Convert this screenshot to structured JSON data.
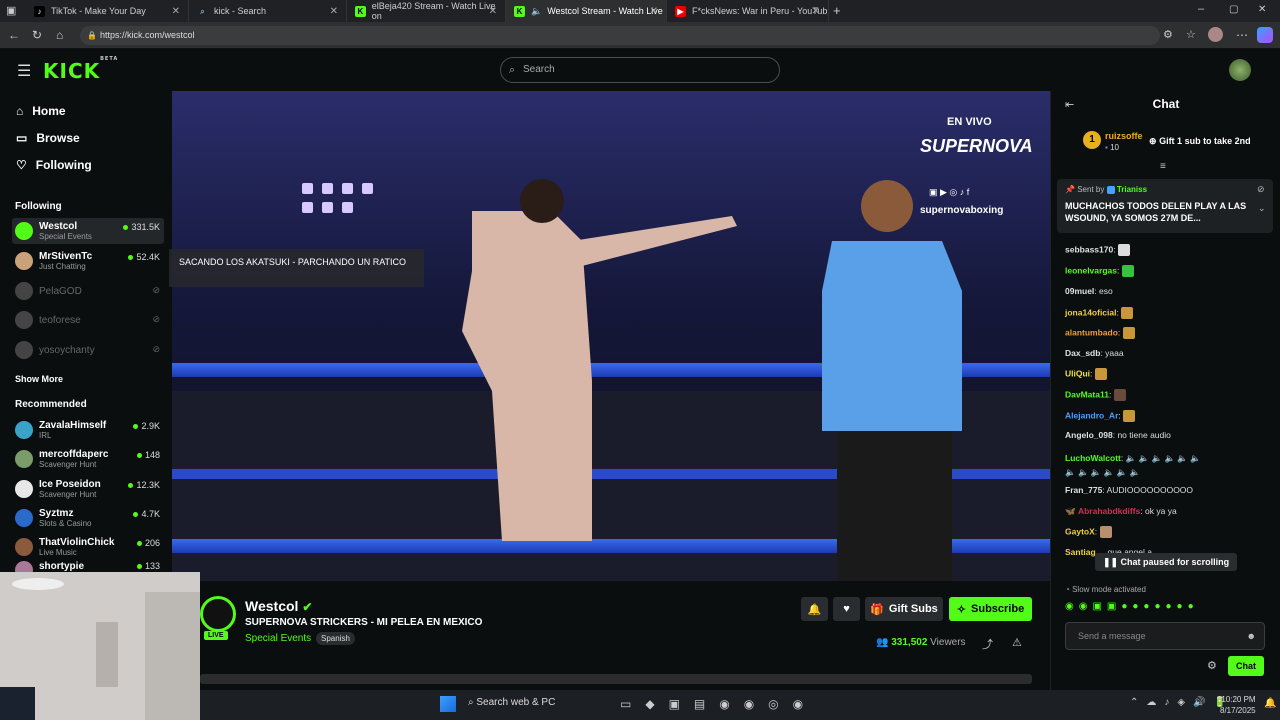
{
  "browser": {
    "tabs": [
      {
        "label": "TikTok - Make Your Day",
        "icon": "tiktok-icon"
      },
      {
        "label": "kick - Search",
        "icon": "search-icon"
      },
      {
        "label": "elBeja420 Stream - Watch Live on",
        "icon": "kick-icon"
      },
      {
        "label": "Westcol Stream - Watch Live",
        "icon": "kick-icon"
      },
      {
        "label": "F*cksNews: War in Peru - YouTub",
        "icon": "youtube-icon"
      }
    ],
    "url": "https://kick.com/westcol"
  },
  "header": {
    "logo": "KICK",
    "logo_badge": "BETA",
    "search_placeholder": "Search"
  },
  "sidebar": {
    "nav": [
      {
        "label": "Home"
      },
      {
        "label": "Browse"
      },
      {
        "label": "Following"
      }
    ],
    "following_title": "Following",
    "following": [
      {
        "name": "Westcol",
        "category": "Special Events",
        "viewers": "331.5K",
        "live": true,
        "color": "#53fc18"
      },
      {
        "name": "MrStivenTc",
        "category": "Just Chatting",
        "viewers": "52.4K",
        "live": true,
        "color": "#c9a27a"
      },
      {
        "name": "PelaGOD",
        "category": "",
        "viewers": "",
        "live": false,
        "color": "#666"
      },
      {
        "name": "teoforese",
        "category": "",
        "viewers": "",
        "live": false,
        "color": "#666"
      },
      {
        "name": "yosoychanty",
        "category": "",
        "viewers": "",
        "live": false,
        "color": "#666"
      }
    ],
    "show_more": "Show More",
    "recommended_title": "Recommended",
    "recommended": [
      {
        "name": "ZavalaHimself",
        "category": "IRL",
        "viewers": "2.9K",
        "color": "#3aa3c7"
      },
      {
        "name": "mercoffdaperc",
        "category": "Scavenger Hunt",
        "viewers": "148",
        "color": "#7a9b6a"
      },
      {
        "name": "Ice Poseidon",
        "category": "Scavenger Hunt",
        "viewers": "12.3K",
        "color": "#e8e8e8"
      },
      {
        "name": "Syztmz",
        "category": "Slots & Casino",
        "viewers": "4.7K",
        "color": "#2a6acb"
      },
      {
        "name": "ThatViolinChick",
        "category": "Live Music",
        "viewers": "206",
        "color": "#8b5a3c"
      },
      {
        "name": "shortypie",
        "category": "",
        "viewers": "133",
        "color": "#aa7799"
      }
    ]
  },
  "video": {
    "overlay_title": "SACANDO LOS AKATSUKI - PARCHANDO UN RATICO",
    "banner_live": "EN VIVO",
    "banner_brand": "SUPERNOVA",
    "banner_handle": "supernovaboxing"
  },
  "stream": {
    "channel": "Westcol",
    "live_badge": "LIVE",
    "title": "SUPERNOVA STRICKERS - MI PELEA EN MEXICO",
    "category": "Special Events",
    "language": "Spanish",
    "gift_label": "Gift Subs",
    "subscribe_label": "Subscribe",
    "viewers": "331,502",
    "viewers_label": "Viewers"
  },
  "chat": {
    "title": "Chat",
    "gifter_rank": "1",
    "gifter_name": "ruizsoffe",
    "gifter_count": "10",
    "gifter_cta": "Gift 1 sub to take 2nd",
    "pinned_by": "Sent by",
    "pinned_user": "Trianiss",
    "pinned_text": "MUCHACHOS TODOS DELEN PLAY A LAS WSOUND, YA SOMOS 27M DE...",
    "messages": [
      {
        "user": "sebbass170",
        "text": "",
        "color": "#e0e0e0",
        "emotes": 1
      },
      {
        "user": "leonelvargas",
        "text": "",
        "color": "#53fc18",
        "emotes": 1
      },
      {
        "user": "09muel",
        "text": "eso",
        "color": "#e0e0e0",
        "emotes": 0
      },
      {
        "user": "jona14oficial",
        "text": "",
        "color": "#f0d040",
        "emotes": 1
      },
      {
        "user": "alantumbado",
        "text": "",
        "color": "#f0a030",
        "emotes": 1
      },
      {
        "user": "Dax_sdb",
        "text": "yaaa",
        "color": "#e0e0e0",
        "emotes": 0
      },
      {
        "user": "UliQui",
        "text": "",
        "color": "#f0e040",
        "emotes": 1
      },
      {
        "user": "DavMata11",
        "text": "",
        "color": "#53fc18",
        "emotes": 1
      },
      {
        "user": "Alejandro_Ar",
        "text": "",
        "color": "#4aa0ff",
        "emotes": 1
      },
      {
        "user": "Angelo_098",
        "text": "no tiene audio",
        "color": "#e0e0e0",
        "emotes": 0
      },
      {
        "user": "LuchoWalcott",
        "text": "",
        "color": "#53fc18",
        "emotes": 6
      },
      {
        "user": "Fran_775",
        "text": "AUDIOOOOOOOOOO",
        "color": "#e0e0e0",
        "emotes": 0
      },
      {
        "user": "Abrahabdkdiffs",
        "text": "ok ya ya",
        "color": "#d03050",
        "emotes": 0
      },
      {
        "user": "GaytoX",
        "text": "",
        "color": "#f0d040",
        "emotes": 1
      },
      {
        "user": "Santiag",
        "text": "... que angel a",
        "color": "#f0d040",
        "emotes": 0
      }
    ],
    "paused": "Chat paused for scrolling",
    "slow_mode": "Slow mode activated",
    "input_placeholder": "Send a message",
    "send_label": "Chat"
  },
  "taskbar": {
    "search": "Search web & PC",
    "time": "10:20 PM",
    "date": "8/17/2025"
  }
}
